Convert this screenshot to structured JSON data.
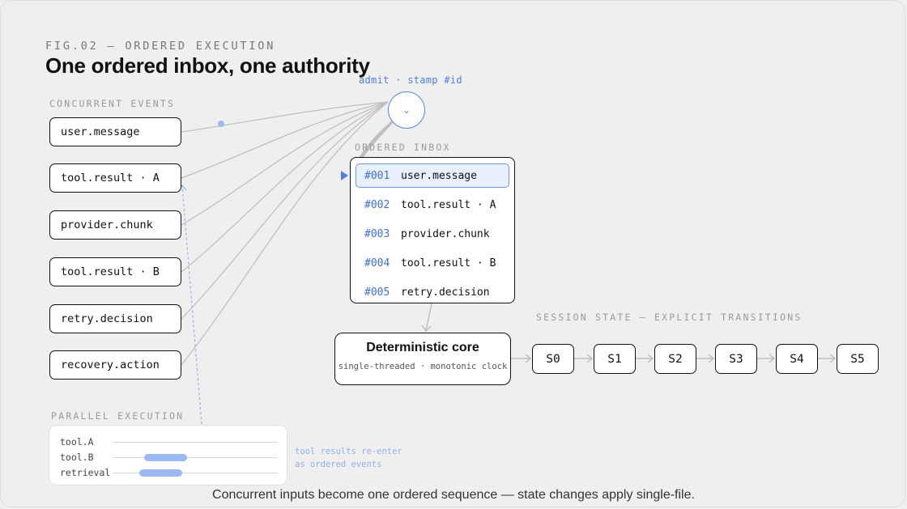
{
  "header": {
    "fig_label": "FIG.02 — ORDERED EXECUTION",
    "title": "One ordered inbox, one authority"
  },
  "gate": {
    "label": "admit · stamp #id",
    "icon": "chevron-down-icon",
    "glyph": "⌄"
  },
  "concurrent": {
    "label": "CONCURRENT EVENTS",
    "events": [
      "user.message",
      "tool.result · A",
      "provider.chunk",
      "tool.result · B",
      "retry.decision",
      "recovery.action"
    ]
  },
  "inbox": {
    "label": "ORDERED INBOX",
    "rows": [
      {
        "id": "#001",
        "name": "user.message"
      },
      {
        "id": "#002",
        "name": "tool.result · A"
      },
      {
        "id": "#003",
        "name": "provider.chunk"
      },
      {
        "id": "#004",
        "name": "tool.result · B"
      },
      {
        "id": "#005",
        "name": "retry.decision"
      }
    ]
  },
  "core": {
    "title": "Deterministic core",
    "subtitle": "single-threaded · monotonic clock"
  },
  "session": {
    "label": "SESSION STATE — EXPLICIT TRANSITIONS",
    "states": [
      "S0",
      "S1",
      "S2",
      "S3",
      "S4",
      "S5"
    ]
  },
  "parallel": {
    "label": "PARALLEL EXECUTION",
    "lanes": [
      {
        "name": "tool.A",
        "busy": null
      },
      {
        "name": "tool.B",
        "busy": [
          0.19,
          0.45
        ]
      },
      {
        "name": "retrieval",
        "busy": [
          0.16,
          0.42
        ]
      }
    ]
  },
  "reenter_note": [
    "tool results re-enter",
    "as ordered events"
  ],
  "caption": "Concurrent inputs become one ordered sequence — state changes apply single-file.",
  "colors": {
    "accent": "#4f7fe3",
    "accent_light": "#9bb9f2",
    "line": "#bdbdbd",
    "ink": "#111111",
    "background": "#efefef"
  }
}
